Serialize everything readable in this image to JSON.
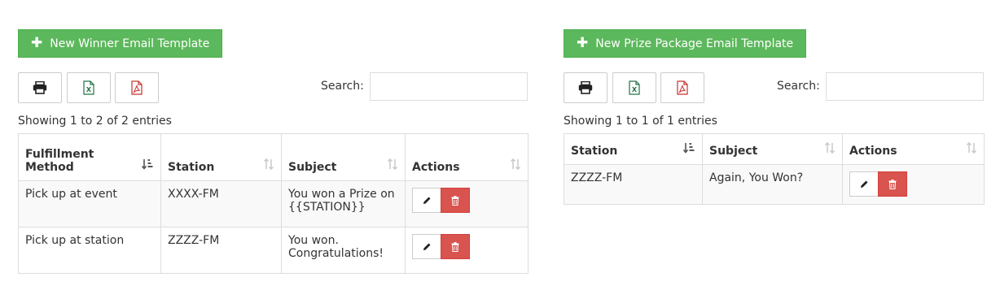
{
  "left": {
    "new_button_label": "New Winner Email Template",
    "search_label": "Search:",
    "info": "Showing 1 to 2 of 2 entries",
    "columns": [
      "Fulfillment Method",
      "Station",
      "Subject",
      "Actions"
    ],
    "rows": [
      {
        "method": "Pick up at event",
        "station": "XXXX-FM",
        "subject": "You won a Prize on {{STATION}}"
      },
      {
        "method": "Pick up at station",
        "station": "ZZZZ-FM",
        "subject": "You won. Congratulations!"
      }
    ]
  },
  "right": {
    "new_button_label": "New Prize Package Email Template",
    "search_label": "Search:",
    "info": "Showing 1 to 1 of 1 entries",
    "columns": [
      "Station",
      "Subject",
      "Actions"
    ],
    "rows": [
      {
        "station": "ZZZZ-FM",
        "subject": "Again, You Won?"
      }
    ]
  },
  "icons": {
    "plus": "plus-icon",
    "print": "print-icon",
    "excel": "excel-icon",
    "pdf": "pdf-icon",
    "edit": "pencil-icon",
    "delete": "trash-icon",
    "sort": "sort-icon"
  },
  "colors": {
    "success": "#5cb85c",
    "danger": "#d9534f",
    "excel": "#217346",
    "pdf": "#c9302c"
  }
}
